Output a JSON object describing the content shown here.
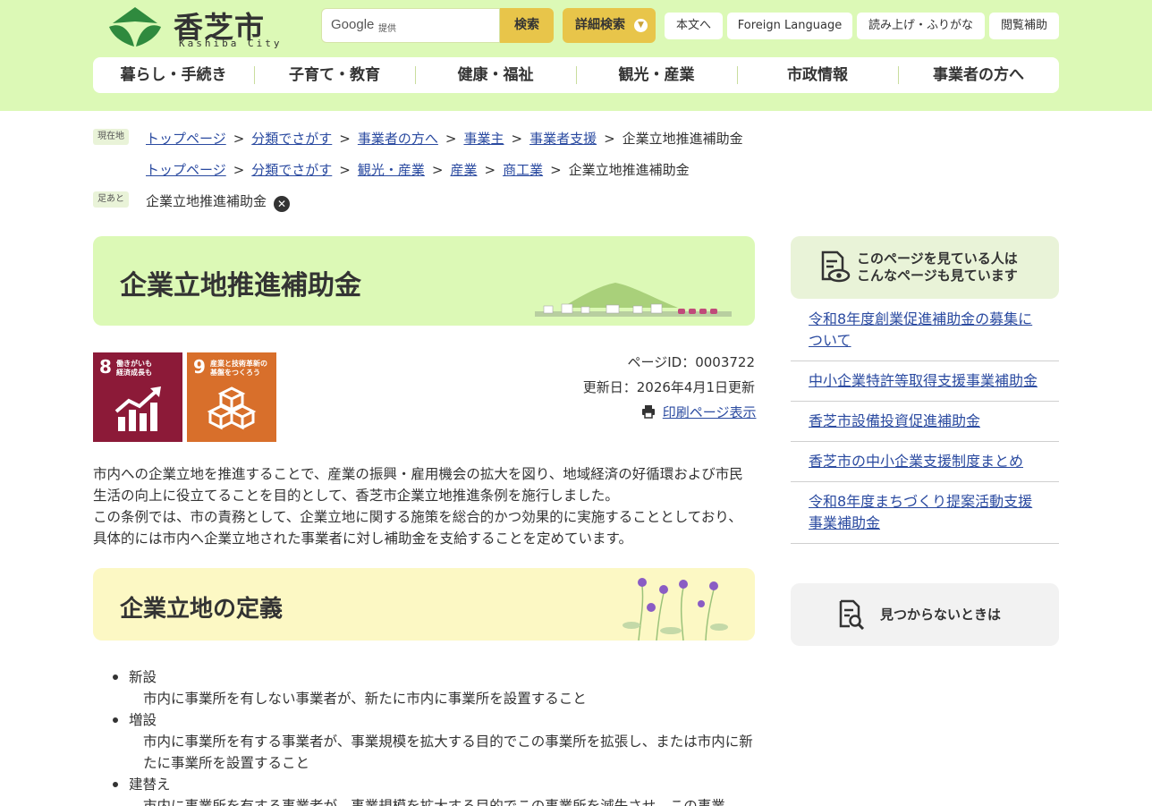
{
  "header": {
    "logo_text": "香芝市",
    "logo_sub": "Kashiba City",
    "search_google": "Google",
    "search_provided": "提供",
    "search_button": "検索",
    "advanced_search": "詳細検索",
    "utility": [
      "本文へ",
      "Foreign Language",
      "読み上げ・ふりがな",
      "閲覧補助"
    ],
    "colors": {
      "band": "#dcf9b6",
      "accent": "#e8c54a"
    }
  },
  "gnav": [
    "暮らし・手続き",
    "子育て・教育",
    "健康・福祉",
    "観光・産業",
    "市政情報",
    "事業者の方へ"
  ],
  "breadcrumbs": {
    "current_label": "現在地",
    "path1": [
      "トップページ",
      "分類でさがす",
      "事業者の方へ",
      "事業主",
      "事業者支援"
    ],
    "path1_current": "企業立地推進補助金",
    "path2": [
      "トップページ",
      "分類でさがす",
      "観光・産業",
      "産業",
      "商工業"
    ],
    "path2_current": "企業立地推進補助金",
    "footprint_label": "足あと",
    "footprint_item": "企業立地推進補助金",
    "footprint_close": "✕"
  },
  "page": {
    "title": "企業立地推進補助金",
    "sdgs": [
      {
        "num": "8",
        "text": "働きがいも\n経済成長も",
        "color": "#8c1a38"
      },
      {
        "num": "9",
        "text": "産業と技術革新の\n基盤をつくろう",
        "color": "#d86f2b"
      }
    ],
    "page_id": "ページID：0003722",
    "updated": "更新日：2026年4月1日更新",
    "print": "印刷ページ表示",
    "paragraph1": "市内への企業立地を推進することで、産業の振興・雇用機会の拡大を図り、地域経済の好循環および市民生活の向上に役立てることを目的として、香芝市企業立地推進条例を施行しました。",
    "paragraph2": "この条例では、市の責務として、企業立地に関する施策を総合的かつ効果的に実施することとしており、具体的には市内へ企業立地された事業者に対し補助金を支給することを定めています。",
    "h2": "企業立地の定義",
    "definitions": [
      {
        "term": "新設",
        "desc": "市内に事業所を有しない事業者が、新たに市内に事業所を設置すること"
      },
      {
        "term": "増設",
        "desc": "市内に事業所を有する事業者が、事業規模を拡大する目的でこの事業所を拡張し、または市内に新たに事業所を設置すること"
      },
      {
        "term": "建替え",
        "desc": "市内に事業所を有する事業者が、事業規模を拡大する目的でこの事業所を滅失させ、この事業"
      }
    ]
  },
  "sidebar": {
    "heading": "このページを見ている人は\nこんなページも見ています",
    "links": [
      "令和8年度創業促進補助金の募集について",
      "中小企業特許等取得支援事業補助金",
      "香芝市設備投資促進補助金",
      "香芝市の中小企業支援制度まとめ",
      "令和8年度まちづくり提案活動支援事業補助金"
    ],
    "notfound": "見つからないときは"
  }
}
